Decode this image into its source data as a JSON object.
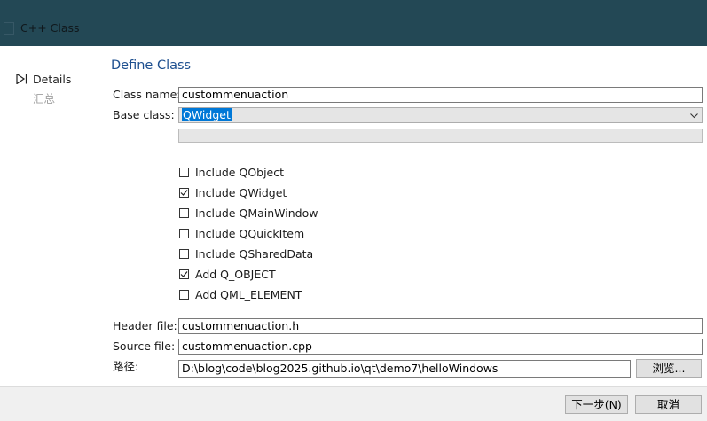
{
  "window": {
    "title": "C++ Class"
  },
  "sidebar": {
    "items": [
      {
        "label": "Details",
        "active": true
      },
      {
        "label": "汇总",
        "active": false
      }
    ]
  },
  "page": {
    "heading": "Define Class"
  },
  "form": {
    "class_name": {
      "label": "Class name:",
      "value": "custommenuaction"
    },
    "base_class": {
      "label": "Base class:",
      "value": "QWidget"
    },
    "checkboxes": [
      {
        "label": "Include QObject",
        "checked": false
      },
      {
        "label": "Include QWidget",
        "checked": true
      },
      {
        "label": "Include QMainWindow",
        "checked": false
      },
      {
        "label": "Include QQuickItem",
        "checked": false
      },
      {
        "label": "Include QSharedData",
        "checked": false
      },
      {
        "label": "Add Q_OBJECT",
        "checked": true
      },
      {
        "label": "Add QML_ELEMENT",
        "checked": false
      }
    ],
    "header_file": {
      "label": "Header file:",
      "value": "custommenuaction.h"
    },
    "source_file": {
      "label": "Source file:",
      "value": "custommenuaction.cpp"
    },
    "path": {
      "label": "路径:",
      "value": "D:\\blog\\code\\blog2025.github.io\\qt\\demo7\\helloWindows",
      "browse_label": "浏览..."
    }
  },
  "footer": {
    "next_label": "下一步(N)",
    "cancel_label": "取消"
  },
  "colors": {
    "titlebar": "#234855",
    "heading": "#1d4f8f",
    "footer": "#f0f0f0"
  }
}
